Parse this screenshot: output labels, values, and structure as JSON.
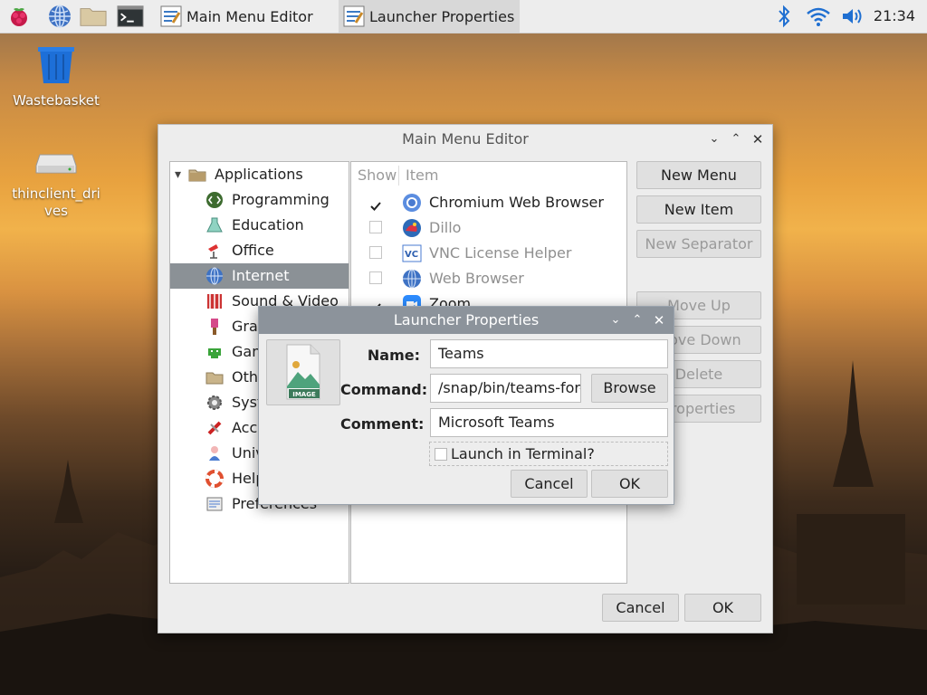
{
  "taskbar": {
    "tasks": [
      {
        "label": "Main Menu Editor"
      },
      {
        "label": "Launcher Properties"
      }
    ],
    "clock": "21:34"
  },
  "desktop": {
    "icons": [
      {
        "label": "Wastebasket"
      },
      {
        "label": "thinclient_drives"
      }
    ]
  },
  "menu_editor": {
    "title": "Main Menu Editor",
    "tree": [
      {
        "label": "Applications",
        "icon": "applications-folder-icon"
      },
      {
        "label": "Programming",
        "icon": "programming-icon"
      },
      {
        "label": "Education",
        "icon": "education-icon"
      },
      {
        "label": "Office",
        "icon": "office-icon"
      },
      {
        "label": "Internet",
        "icon": "internet-globe-icon",
        "selected": true
      },
      {
        "label": "Sound & Video",
        "icon": "sound-video-icon"
      },
      {
        "label": "Graphics",
        "icon": "graphics-icon"
      },
      {
        "label": "Games",
        "icon": "games-icon"
      },
      {
        "label": "Other",
        "icon": "other-icon"
      },
      {
        "label": "System Tools",
        "icon": "system-tools-icon"
      },
      {
        "label": "Accessories",
        "icon": "accessories-icon"
      },
      {
        "label": "Universal Access",
        "icon": "universal-access-icon"
      },
      {
        "label": "Help",
        "icon": "help-icon"
      },
      {
        "label": "Preferences",
        "icon": "preferences-icon"
      }
    ],
    "columns": {
      "show": "Show",
      "item": "Item"
    },
    "items": [
      {
        "label": "Chromium Web Browser",
        "show": true,
        "icon": "chromium-icon"
      },
      {
        "label": "Dillo",
        "show": false,
        "icon": "dillo-icon"
      },
      {
        "label": "VNC License Helper",
        "show": false,
        "icon": "vnc-icon"
      },
      {
        "label": "Web Browser",
        "show": false,
        "icon": "web-browser-icon"
      },
      {
        "label": "Zoom",
        "show": true,
        "icon": "zoom-icon"
      }
    ],
    "buttons": {
      "new_menu": "New Menu",
      "new_item": "New Item",
      "new_separator": "New Separator",
      "move_up": "Move Up",
      "move_down": "Move Down",
      "delete": "Delete",
      "properties": "Properties",
      "cancel": "Cancel",
      "ok": "OK"
    }
  },
  "launcher": {
    "title": "Launcher Properties",
    "icon_caption": "IMAGE",
    "name_label": "Name:",
    "name_value": "Teams",
    "command_label": "Command:",
    "command_value": "/snap/bin/teams-for-l",
    "browse": "Browse",
    "comment_label": "Comment:",
    "comment_value": "Microsoft Teams",
    "terminal_label": "Launch in Terminal?",
    "terminal_checked": false,
    "cancel": "Cancel",
    "ok": "OK"
  }
}
